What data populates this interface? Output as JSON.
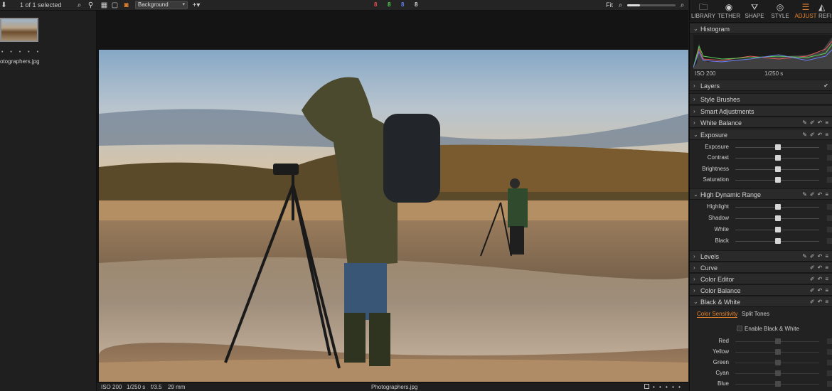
{
  "topbar": {
    "selected_label": "1 of 1 selected",
    "variant_select_value": "Background",
    "counts": [
      {
        "label": "8",
        "color": "#e84c4c"
      },
      {
        "label": "8",
        "color": "#4cd24c"
      },
      {
        "label": "8",
        "color": "#5b7ff5"
      },
      {
        "label": "8",
        "color": "#d8d8d8"
      }
    ],
    "fit_label": "Fit"
  },
  "browser": {
    "thumbnail_name": "otographers.jpg",
    "stars": "• • • • •"
  },
  "viewer": {
    "iso": "ISO 200",
    "shutter": "1/250 s",
    "aperture": "f/3.5",
    "focal": "29 mm",
    "filename": "Photographers.jpg",
    "page_dots": "• • • • •"
  },
  "tool_tabs": [
    {
      "label": "LIBRARY",
      "icon": "folder-icon"
    },
    {
      "label": "TETHER",
      "icon": "camera-icon"
    },
    {
      "label": "SHAPE",
      "icon": "shape-icon"
    },
    {
      "label": "STYLE",
      "icon": "style-icon"
    },
    {
      "label": "ADJUST",
      "icon": "sliders-icon"
    },
    {
      "label": "REFI",
      "icon": "refine-icon"
    }
  ],
  "histogram": {
    "title": "Histogram",
    "iso": "ISO 200",
    "shutter": "1/250 s"
  },
  "sections": {
    "layers": "Layers",
    "style_brushes": "Style Brushes",
    "smart_adjustments": "Smart Adjustments",
    "white_balance": "White Balance",
    "exposure": "Exposure",
    "hdr": "High Dynamic Range",
    "levels": "Levels",
    "curve": "Curve",
    "color_editor": "Color Editor",
    "color_balance": "Color Balance",
    "black_white": "Black & White"
  },
  "exposure_sliders": [
    {
      "label": "Exposure",
      "value": 0
    },
    {
      "label": "Contrast",
      "value": 0
    },
    {
      "label": "Brightness",
      "value": 0
    },
    {
      "label": "Saturation",
      "value": 0
    }
  ],
  "hdr_sliders": [
    {
      "label": "Highlight",
      "value": 0
    },
    {
      "label": "Shadow",
      "value": 0
    },
    {
      "label": "White",
      "value": 0
    },
    {
      "label": "Black",
      "value": 0
    }
  ],
  "bw": {
    "tab_sensitivity": "Color Sensitivity",
    "tab_split": "Split Tones",
    "enable_label": "Enable Black & White",
    "sliders": [
      {
        "label": "Red",
        "value": 0
      },
      {
        "label": "Yellow",
        "value": 0
      },
      {
        "label": "Green",
        "value": 0
      },
      {
        "label": "Cyan",
        "value": 0
      },
      {
        "label": "Blue",
        "value": 0
      }
    ]
  },
  "colors": {
    "accent": "#e8842c"
  }
}
